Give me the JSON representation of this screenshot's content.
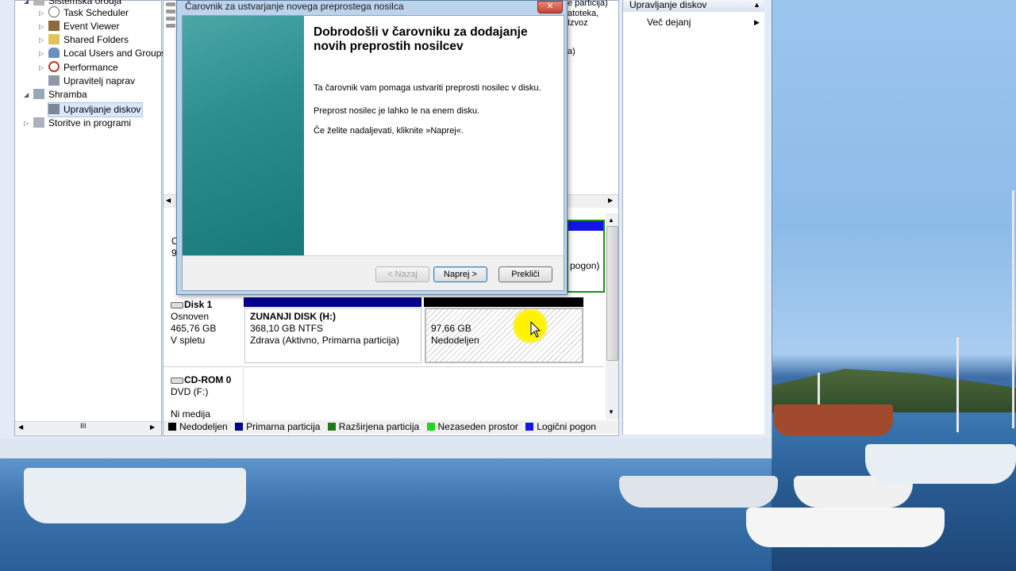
{
  "tree": {
    "items": [
      {
        "label": "Sistemska orodja"
      },
      {
        "label": "Task Scheduler"
      },
      {
        "label": "Event Viewer"
      },
      {
        "label": "Shared Folders"
      },
      {
        "label": "Local Users and Groups"
      },
      {
        "label": "Performance"
      },
      {
        "label": "Upravitelj naprav"
      },
      {
        "label": "Shramba"
      },
      {
        "label": "Upravljanje diskov"
      },
      {
        "label": "Storitve in programi"
      }
    ],
    "scroll_grip": "III"
  },
  "center": {
    "top_fragments": [
      "e particija)",
      "atoteka, Izvoz",
      "a)"
    ],
    "mid_fragments": [
      "O",
      "9"
    ],
    "volume_fragment": "pogon)"
  },
  "disk1": {
    "name": "Disk 1",
    "type": "Osnoven",
    "size": "465,76 GB",
    "status": "V spletu",
    "partitions": [
      {
        "title": "ZUNANJI DISK  (H:)",
        "size": "368,10 GB NTFS",
        "status": "Zdrava (Aktivno, Primarna particija)"
      },
      {
        "size": "97,66 GB",
        "status": "Nedodeljen"
      }
    ]
  },
  "cdrom": {
    "name": "CD-ROM 0",
    "type": "DVD (F:)",
    "status": "Ni medija"
  },
  "legend": [
    {
      "label": "Nedodeljen",
      "color": "#000000"
    },
    {
      "label": "Primarna particija",
      "color": "#00008b"
    },
    {
      "label": "Razširjena particija",
      "color": "#1f7a1f"
    },
    {
      "label": "Nezaseden prostor",
      "color": "#22d322"
    },
    {
      "label": "Logični pogon",
      "color": "#1414e6"
    }
  ],
  "actions": {
    "header": "Upravljanje diskov",
    "more": "Več dejanj"
  },
  "wizard": {
    "title": "Čarovnik za ustvarjanje novega preprostega nosilca",
    "heading": "Dobrodošli v čarovniku za dodajanje novih preprostih nosilcev",
    "p1": "Ta čarovnik vam pomaga ustvariti preprosti nosilec v disku.",
    "p2": "Preprost nosilec je lahko le na enem disku.",
    "p3": "Če želite nadaljevati, kliknite »Naprej«.",
    "back": "< Nazaj",
    "next": "Naprej >",
    "cancel": "Prekliči",
    "close_glyph": "✕"
  }
}
